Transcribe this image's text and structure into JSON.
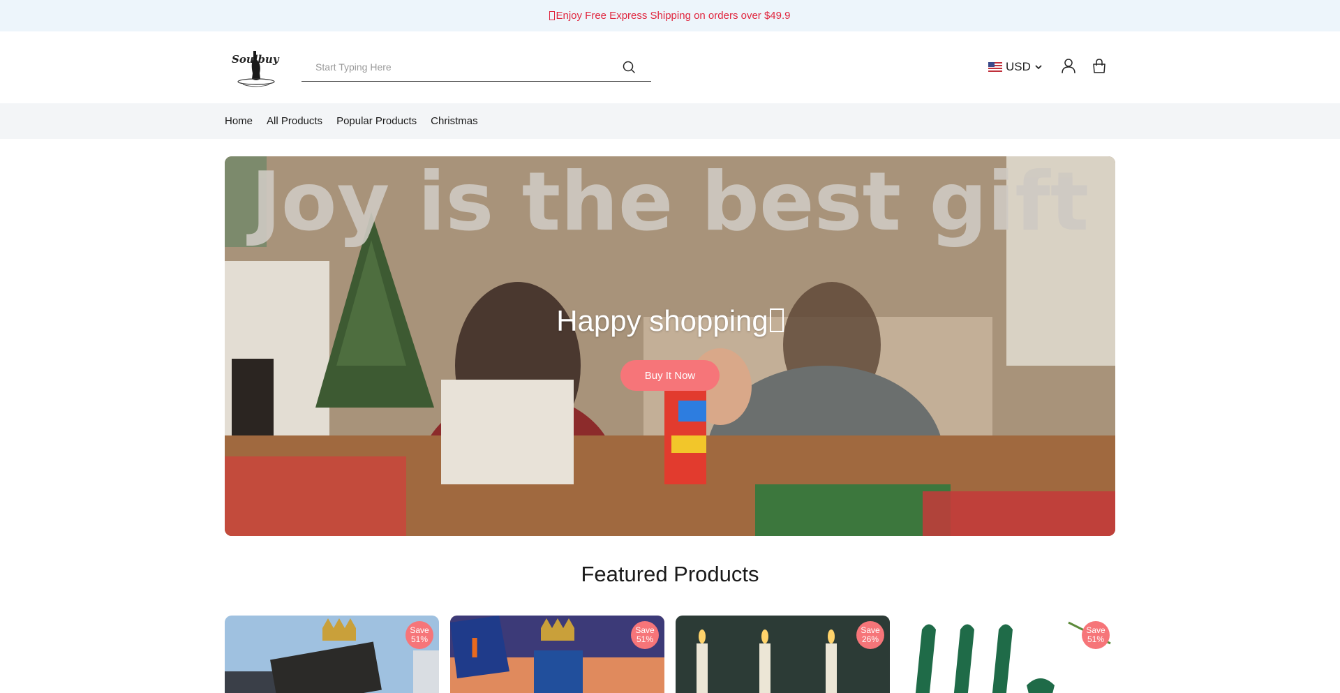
{
  "announcement": {
    "text": "Enjoy Free Express Shipping on orders over $49.9"
  },
  "header": {
    "logo_text": "Soulbuy",
    "search": {
      "placeholder": "Start Typing Here",
      "value": ""
    },
    "currency": "USD"
  },
  "nav": {
    "items": [
      "Home",
      "All Products",
      "Popular Products",
      "Christmas"
    ]
  },
  "hero": {
    "image_text": "Joy is the best gift",
    "title": "Happy shopping",
    "button_label": "Buy It Now"
  },
  "featured": {
    "title": "Featured Products",
    "products": [
      {
        "save_label": "Save",
        "save_percent": "51%"
      },
      {
        "save_label": "Save",
        "save_percent": "51%"
      },
      {
        "save_label": "Save",
        "save_percent": "26%"
      },
      {
        "save_label": "Save",
        "save_percent": "51%"
      }
    ]
  },
  "colors": {
    "accent": "#f67579",
    "announcement_text": "#e0263e",
    "announcement_bg": "#edf5fb",
    "nav_bg": "#f3f5f7"
  },
  "icons": [
    "gift-icon",
    "search-icon",
    "us-flag-icon",
    "chevron-down-icon",
    "user-icon",
    "cart-icon"
  ]
}
